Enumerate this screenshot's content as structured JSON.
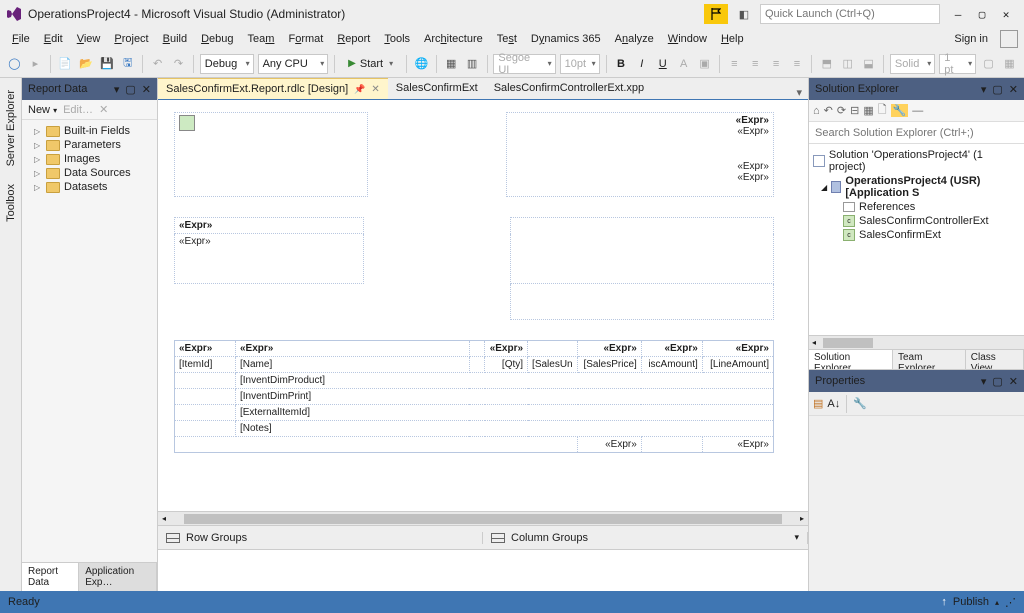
{
  "title": "OperationsProject4 - Microsoft Visual Studio  (Administrator)",
  "quick_launch_placeholder": "Quick Launch (Ctrl+Q)",
  "sign_in": "Sign in",
  "menu": [
    "File",
    "Edit",
    "View",
    "Project",
    "Build",
    "Debug",
    "Team",
    "Format",
    "Report",
    "Tools",
    "Architecture",
    "Test",
    "Dynamics 365",
    "Analyze",
    "Window",
    "Help"
  ],
  "toolbar": {
    "config": "Debug",
    "platform": "Any CPU",
    "start": "Start",
    "font": "Segoe UI",
    "fontsize": "10pt",
    "border": "Solid",
    "borderpt": "1 pt"
  },
  "left_tabs": [
    "Server Explorer",
    "Toolbox"
  ],
  "report_data": {
    "title": "Report Data",
    "new": "New",
    "edit": "Edit…",
    "tree": [
      "Built-in Fields",
      "Parameters",
      "Images",
      "Data Sources",
      "Datasets"
    ],
    "bottom_tabs": [
      "Report Data",
      "Application Exp…"
    ]
  },
  "doc_tabs": [
    {
      "label": "SalesConfirmExt.Report.rdlc [Design]",
      "active": true
    },
    {
      "label": "SalesConfirmExt",
      "active": false
    },
    {
      "label": "SalesConfirmControllerExt.xpp",
      "active": false
    }
  ],
  "report": {
    "expr": "«Expr»",
    "table_headers": [
      "«Expr»",
      "«Expr»",
      "",
      "«Expr»",
      "",
      "«Expr»",
      "«Expr»",
      "«Expr»"
    ],
    "row1": [
      "[ItemId]",
      "[Name]",
      "",
      "[Qty]",
      "[SalesUn",
      "[SalesPrice]",
      "iscAmount]",
      "[LineAmount]"
    ],
    "detail_rows": [
      "[InventDimProduct]",
      "[InventDimPrint]",
      "[ExternalItemId]",
      "[Notes]"
    ],
    "footer": [
      "«Expr»",
      "«Expr»"
    ]
  },
  "groups": {
    "row": "Row Groups",
    "col": "Column Groups"
  },
  "solution_explorer": {
    "title": "Solution Explorer",
    "search_placeholder": "Search Solution Explorer (Ctrl+;)",
    "solution": "Solution 'OperationsProject4' (1 project)",
    "project": "OperationsProject4 (USR) [Application S",
    "refs": "References",
    "items": [
      "SalesConfirmControllerExt",
      "SalesConfirmExt"
    ],
    "tabs": [
      "Solution Explorer",
      "Team Explorer",
      "Class View"
    ]
  },
  "properties": {
    "title": "Properties"
  },
  "status": {
    "ready": "Ready",
    "publish": "Publish"
  }
}
